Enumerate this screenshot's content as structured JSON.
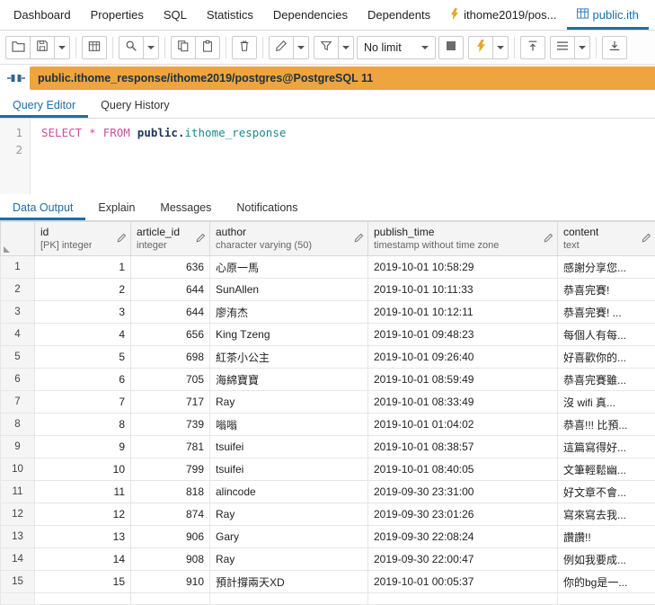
{
  "colors": {
    "accent_blue": "#1b6fa8",
    "banner_orange": "#eea43f",
    "keyword_pink": "#c94f9d",
    "table_teal": "#1a8a8a",
    "execute_yellow": "#e3a72c"
  },
  "nav": {
    "tabs": [
      {
        "label": "Dashboard"
      },
      {
        "label": "Properties"
      },
      {
        "label": "SQL"
      },
      {
        "label": "Statistics"
      },
      {
        "label": "Dependencies"
      },
      {
        "label": "Dependents"
      },
      {
        "label": "ithome2019/pos...",
        "icon": "lightning-icon"
      },
      {
        "label": "public.ith",
        "icon": "table-icon",
        "active": true
      }
    ]
  },
  "toolbar": {
    "limit_value": "No limit",
    "buttons": [
      {
        "name": "open-file-button",
        "icon": "folder-open-icon"
      },
      {
        "name": "save-button",
        "icon": "save-icon",
        "has_dropdown": true
      },
      {
        "name": "save-data-changes-button",
        "icon": "table-icon"
      },
      {
        "name": "find-button",
        "icon": "search-icon",
        "has_dropdown": true
      },
      {
        "name": "copy-button",
        "icon": "copy-icon"
      },
      {
        "name": "paste-button",
        "icon": "paste-icon"
      },
      {
        "name": "delete-button",
        "icon": "trash-icon"
      },
      {
        "name": "edit-button",
        "icon": "pencil-icon",
        "has_dropdown": true
      },
      {
        "name": "filter-button",
        "icon": "funnel-icon",
        "has_dropdown": true
      },
      {
        "name": "limit-select",
        "value": "No limit"
      },
      {
        "name": "cancel-query-button",
        "icon": "stop-icon"
      },
      {
        "name": "execute-button",
        "icon": "lightning-icon",
        "has_dropdown": true
      },
      {
        "name": "commit-button",
        "icon": "commit-icon"
      },
      {
        "name": "macros-button",
        "icon": "menu-icon",
        "has_dropdown": true
      },
      {
        "name": "download-button",
        "icon": "download-icon"
      }
    ]
  },
  "connection": {
    "label": "public.ithome_response/ithome2019/postgres@PostgreSQL 11"
  },
  "editor_tabs": [
    {
      "label": "Query Editor",
      "active": true
    },
    {
      "label": "Query History",
      "active": false
    }
  ],
  "sql": {
    "line_numbers": [
      "1",
      "2"
    ],
    "select_keyword": "SELECT",
    "star": "*",
    "from_keyword": "FROM",
    "schema": "public",
    "dot": ".",
    "table": "ithome_response"
  },
  "output_tabs": [
    {
      "label": "Data Output",
      "active": true
    },
    {
      "label": "Explain",
      "active": false
    },
    {
      "label": "Messages",
      "active": false
    },
    {
      "label": "Notifications",
      "active": false
    }
  ],
  "grid": {
    "columns": [
      {
        "key": "id",
        "name": "id",
        "type": "[PK] integer"
      },
      {
        "key": "article_id",
        "name": "article_id",
        "type": "integer"
      },
      {
        "key": "author",
        "name": "author",
        "type": "character varying (50)"
      },
      {
        "key": "publish_time",
        "name": "publish_time",
        "type": "timestamp without time zone"
      },
      {
        "key": "content",
        "name": "content",
        "type": "text"
      }
    ],
    "rows": [
      {
        "num": "1",
        "id": "1",
        "article_id": "636",
        "author": "心原一馬",
        "publish_time": "2019-10-01 10:58:29",
        "content": "感謝分享您..."
      },
      {
        "num": "2",
        "id": "2",
        "article_id": "644",
        "author": "SunAllen",
        "publish_time": "2019-10-01 10:11:33",
        "content": "恭喜完賽!"
      },
      {
        "num": "3",
        "id": "3",
        "article_id": "644",
        "author": "廖洧杰",
        "publish_time": "2019-10-01 10:12:11",
        "content": "恭喜完賽! ..."
      },
      {
        "num": "4",
        "id": "4",
        "article_id": "656",
        "author": "King Tzeng",
        "publish_time": "2019-10-01 09:48:23",
        "content": "每個人有每..."
      },
      {
        "num": "5",
        "id": "5",
        "article_id": "698",
        "author": "紅茶小公主",
        "publish_time": "2019-10-01 09:26:40",
        "content": "好喜歡你的..."
      },
      {
        "num": "6",
        "id": "6",
        "article_id": "705",
        "author": "海綿寶寶",
        "publish_time": "2019-10-01 08:59:49",
        "content": "恭喜完賽雖..."
      },
      {
        "num": "7",
        "id": "7",
        "article_id": "717",
        "author": "Ray",
        "publish_time": "2019-10-01 08:33:49",
        "content": "沒 wifi 真..."
      },
      {
        "num": "8",
        "id": "8",
        "article_id": "739",
        "author": "嗡嗡",
        "publish_time": "2019-10-01 01:04:02",
        "content": "恭喜!!! 比預..."
      },
      {
        "num": "9",
        "id": "9",
        "article_id": "781",
        "author": "tsuifei",
        "publish_time": "2019-10-01 08:38:57",
        "content": "這篇寫得好..."
      },
      {
        "num": "10",
        "id": "10",
        "article_id": "799",
        "author": "tsuifei",
        "publish_time": "2019-10-01 08:40:05",
        "content": "文筆輕鬆幽..."
      },
      {
        "num": "11",
        "id": "11",
        "article_id": "818",
        "author": "alincode",
        "publish_time": "2019-09-30 23:31:00",
        "content": "好文章不會..."
      },
      {
        "num": "12",
        "id": "12",
        "article_id": "874",
        "author": "Ray",
        "publish_time": "2019-09-30 23:01:26",
        "content": "寫來寫去我..."
      },
      {
        "num": "13",
        "id": "13",
        "article_id": "906",
        "author": "Gary",
        "publish_time": "2019-09-30 22:08:24",
        "content": "讚讚!!"
      },
      {
        "num": "14",
        "id": "14",
        "article_id": "908",
        "author": "Ray",
        "publish_time": "2019-09-30 22:00:47",
        "content": "例如我要成..."
      },
      {
        "num": "15",
        "id": "15",
        "article_id": "910",
        "author": "預計撐兩天XD",
        "publish_time": "2019-10-01 00:05:37",
        "content": "你的bg是一..."
      }
    ]
  }
}
